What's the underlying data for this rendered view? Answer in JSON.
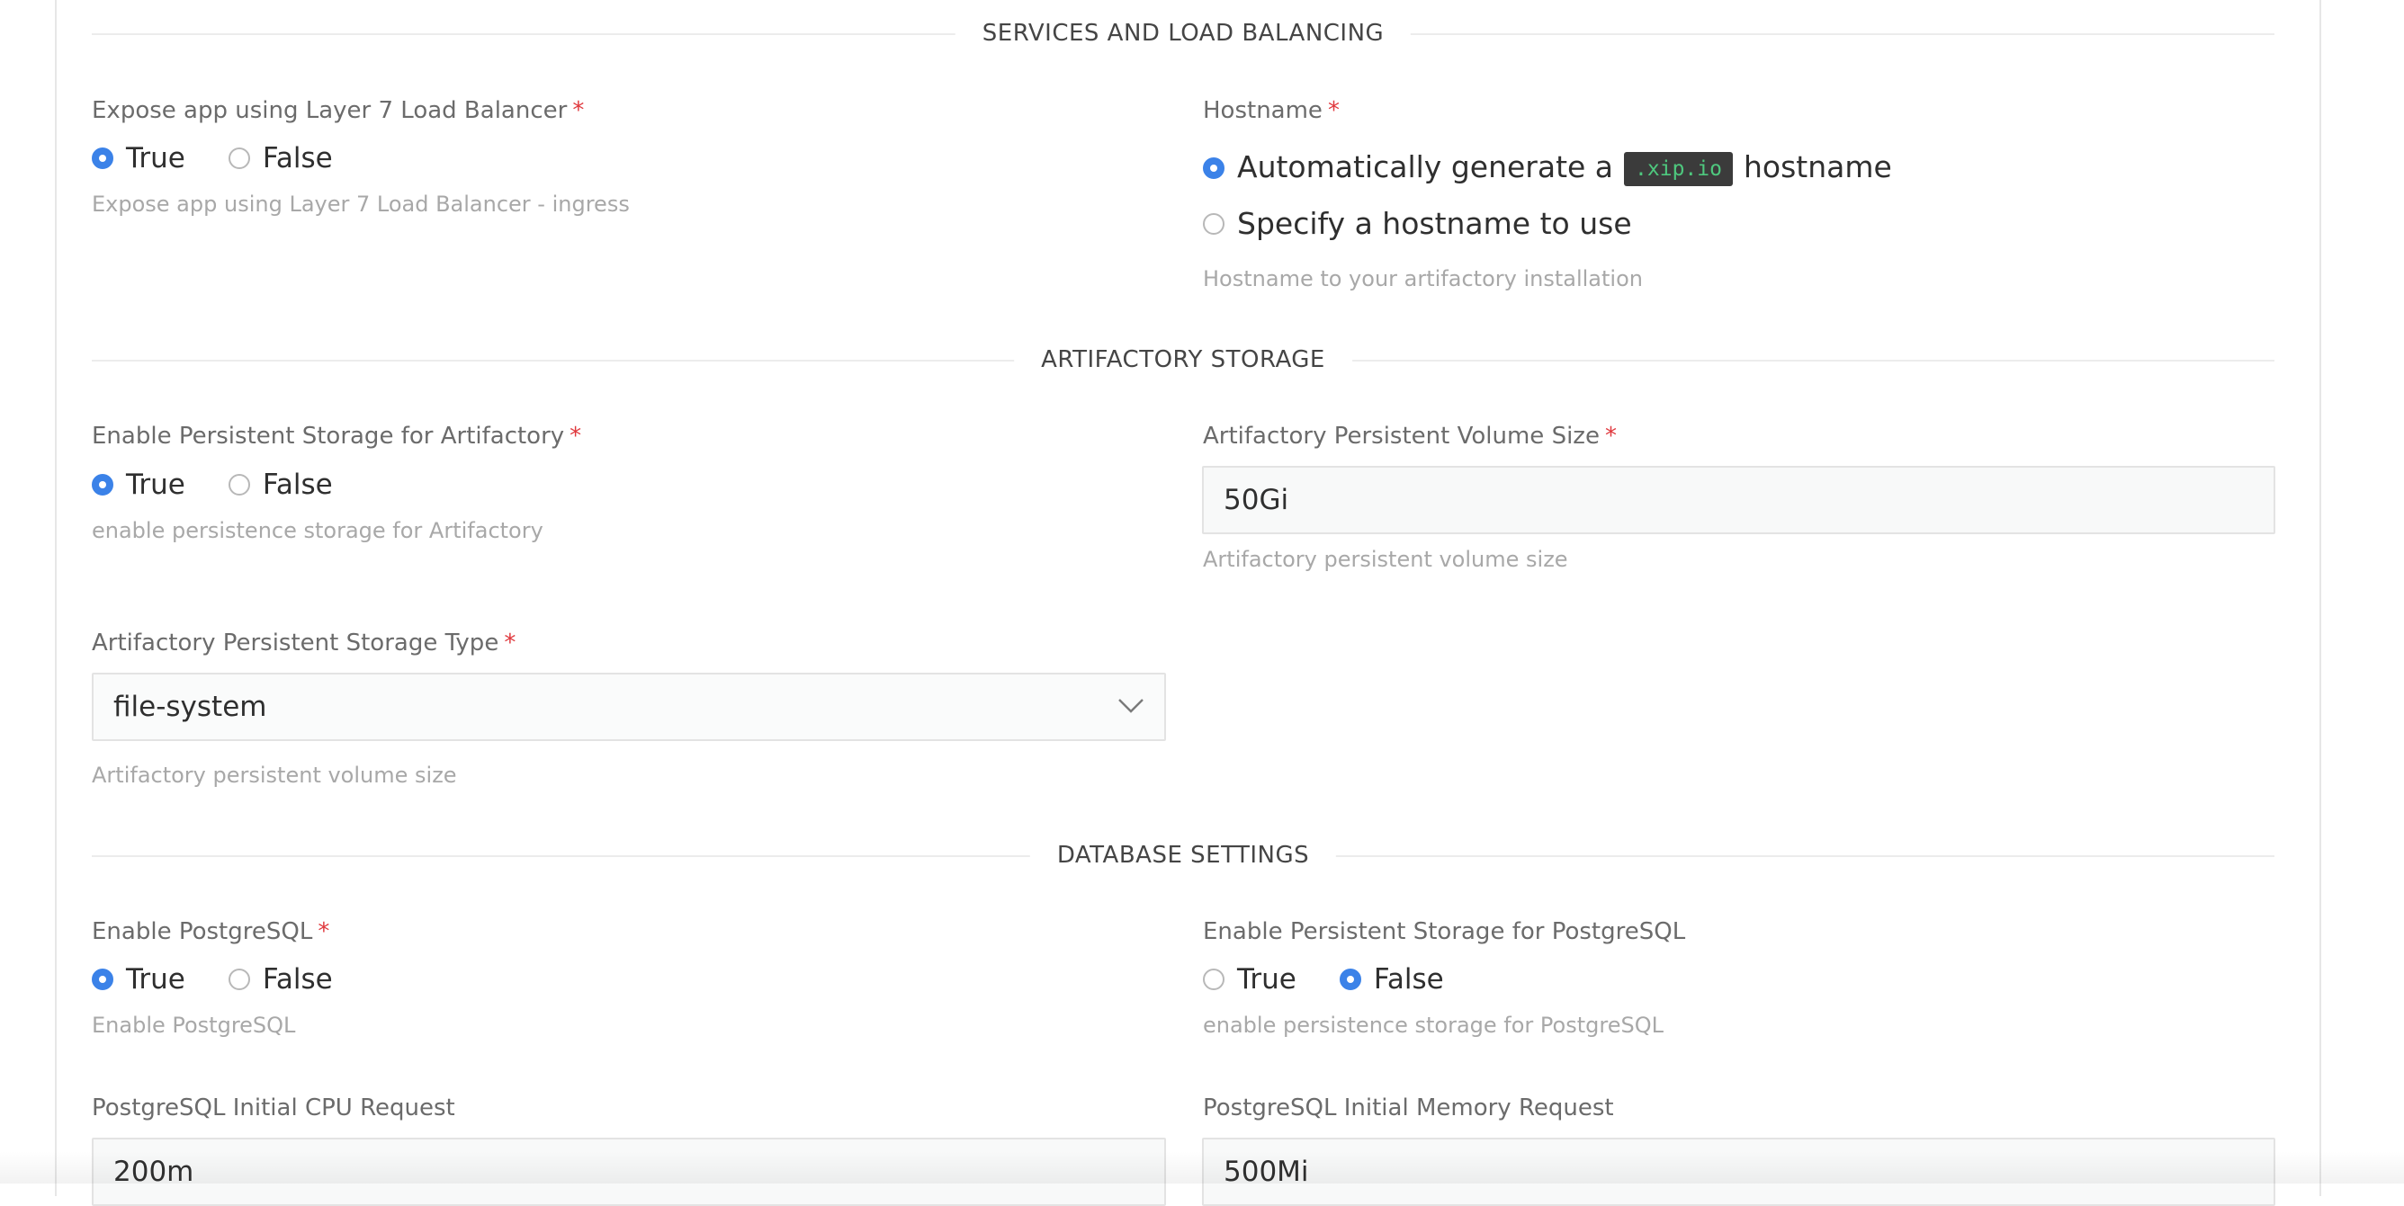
{
  "sections": {
    "services": "SERVICES AND LOAD BALANCING",
    "storage": "ARTIFACTORY STORAGE",
    "database": "DATABASE SETTINGS"
  },
  "expose": {
    "label": "Expose app using Layer 7 Load Balancer",
    "required": "*",
    "options": [
      "True",
      "False"
    ],
    "selected": "True",
    "hint": "Expose app using Layer 7 Load Balancer - ingress"
  },
  "hostname": {
    "label": "Hostname",
    "required": "*",
    "option_auto_prefix": "Automatically generate a",
    "option_auto_code": ".xip.io",
    "option_auto_suffix": "hostname",
    "option_specify": "Specify a hostname to use",
    "selected": "auto",
    "hint": "Hostname to your artifactory installation"
  },
  "persistence": {
    "label": "Enable Persistent Storage for Artifactory",
    "required": "*",
    "options": [
      "True",
      "False"
    ],
    "selected": "True",
    "hint": "enable persistence storage for Artifactory"
  },
  "volume_size": {
    "label": "Artifactory Persistent Volume Size",
    "required": "*",
    "value": "50Gi",
    "hint": "Artifactory persistent volume size"
  },
  "storage_type": {
    "label": "Artifactory Persistent Storage Type",
    "required": "*",
    "value": "file-system",
    "hint": "Artifactory persistent volume size"
  },
  "postgres": {
    "label": "Enable PostgreSQL",
    "required": "*",
    "options": [
      "True",
      "False"
    ],
    "selected": "True",
    "hint": "Enable PostgreSQL"
  },
  "postgres_persistence": {
    "label": "Enable Persistent Storage for PostgreSQL",
    "options": [
      "True",
      "False"
    ],
    "selected": "False",
    "hint": "enable persistence storage for PostgreSQL"
  },
  "cpu_request": {
    "label": "PostgreSQL Initial CPU Request",
    "value": "200m"
  },
  "memory_request": {
    "label": "PostgreSQL Initial Memory Request",
    "value": "500Mi"
  },
  "colors": {
    "accent": "#3b82e8",
    "required": "#e0393e",
    "code_bg": "#3b3b3b",
    "code_fg": "#4ec87e"
  },
  "icons": {
    "select_caret": "chevron-down-icon"
  }
}
